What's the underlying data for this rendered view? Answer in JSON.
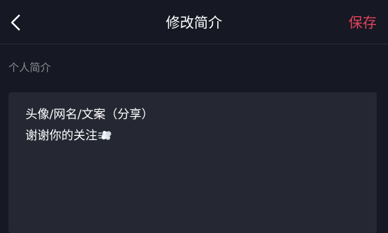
{
  "header": {
    "title": "修改简介",
    "save_label": "保存",
    "back_icon": "chevron-left-icon"
  },
  "section": {
    "label": "个人简介"
  },
  "bio": {
    "line1": "头像/网名/文案（分享）",
    "line2": "谢谢你的关注",
    "emoji_icon": "dash-puff-emoji-icon"
  },
  "colors": {
    "background": "#161823",
    "input_background": "#252732",
    "accent": "#e2435a",
    "label_text": "#8a8b91"
  }
}
